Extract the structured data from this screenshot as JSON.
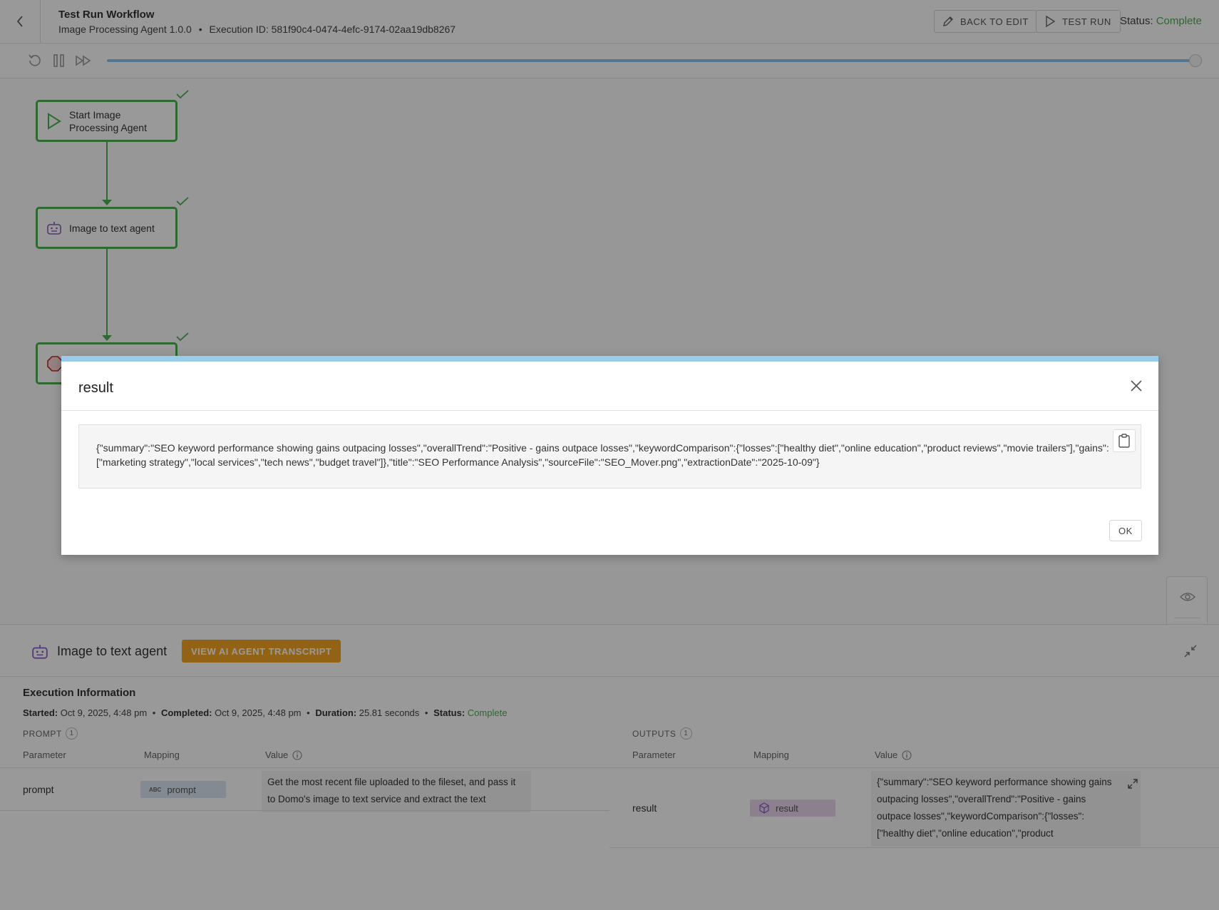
{
  "header": {
    "title": "Test Run Workflow",
    "agent_name": "Image Processing Agent 1.0.0",
    "separator": "•",
    "execution_id": "Execution ID: 581f90c4-0474-4efc-9174-02aa19db8267",
    "back_to_edit_label": "BACK TO EDIT",
    "test_run_label": "TEST RUN",
    "status_label": "Status:",
    "status_value": "Complete",
    "status_color": "#4caf50"
  },
  "canvas": {
    "nodes": [
      {
        "label_line1": "Start Image",
        "label_line2": "Processing Agent",
        "icon": "play-icon"
      },
      {
        "label": "Image to text agent",
        "icon": "robot-icon"
      },
      {
        "label": "",
        "icon": "stop-icon"
      }
    ]
  },
  "bottom_panel": {
    "title": "Image to text agent",
    "transcript_button": "VIEW AI AGENT TRANSCRIPT",
    "accent_color": "#f6a623",
    "exec_title": "Execution Information",
    "started_label": "Started:",
    "started_value": "Oct 9, 2025, 4:48 pm",
    "completed_label": "Completed:",
    "completed_value": "Oct 9, 2025, 4:48 pm",
    "duration_label": "Duration:",
    "duration_value": "25.81 seconds",
    "status_label": "Status:",
    "status_value": "Complete",
    "dot": "•",
    "prompt_section": {
      "label": "PROMPT",
      "count": "1",
      "columns": [
        "Parameter",
        "Mapping",
        "Value"
      ],
      "row": {
        "parameter": "prompt",
        "mapping_icon_text": "ABC",
        "mapping": "prompt",
        "value": "Get the most recent file uploaded to the fileset, and pass it to Domo's image to text service and extract the text"
      }
    },
    "outputs_section": {
      "label": "OUTPUTS",
      "count": "1",
      "columns": [
        "Parameter",
        "Mapping",
        "Value"
      ],
      "row": {
        "parameter": "result",
        "mapping": "result",
        "value": "{\"summary\":\"SEO keyword performance showing gains outpacing losses\",\"overallTrend\":\"Positive - gains outpace losses\",\"keywordComparison\":{\"losses\":[\"healthy diet\",\"online education\",\"product reviews\",\"movie"
      }
    }
  },
  "modal": {
    "title": "result",
    "content": "{\"summary\":\"SEO keyword performance showing gains outpacing losses\",\"overallTrend\":\"Positive - gains outpace losses\",\"keywordComparison\":{\"losses\":[\"healthy diet\",\"online education\",\"product reviews\",\"movie trailers\"],\"gains\":[\"marketing strategy\",\"local services\",\"tech news\",\"budget travel\"]},\"title\":\"SEO Performance Analysis\",\"sourceFile\":\"SEO_Mover.png\",\"extractionDate\":\"2025-10-09\"}",
    "ok_label": "OK",
    "accent_color": "#99cbeb"
  }
}
